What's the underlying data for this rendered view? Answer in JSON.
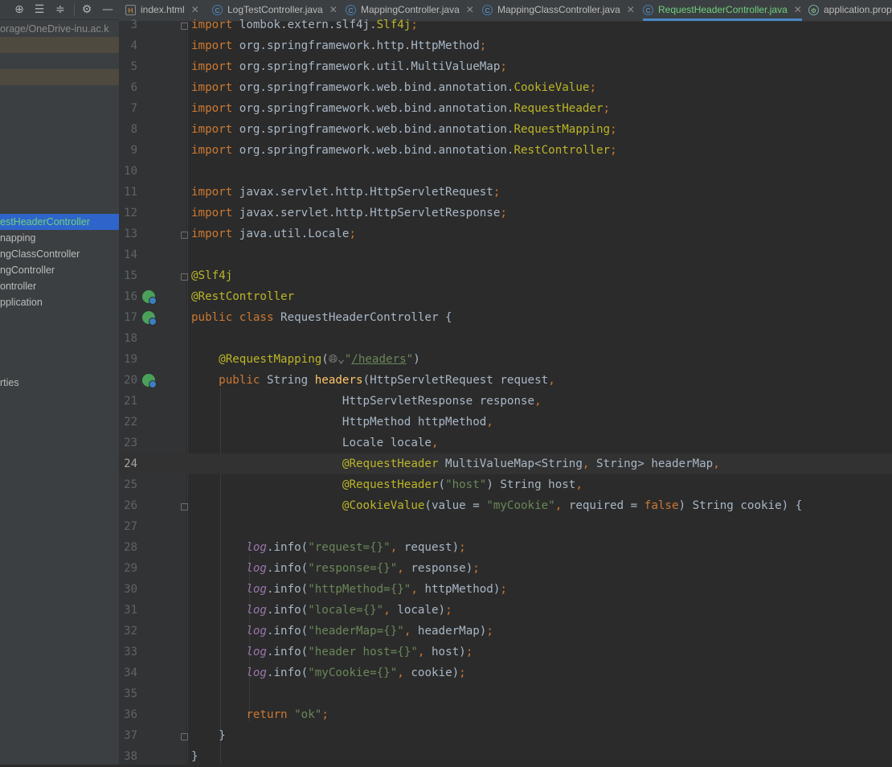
{
  "sidebar": {
    "toolbar_icons": [
      "target-icon",
      "expand-all-icon",
      "collapse-all-icon",
      "gear-icon",
      "minimize-icon"
    ],
    "project_path": "orage/OneDrive-inu.ac.k",
    "items": [
      {
        "label": "estHeaderController",
        "selected": true
      },
      {
        "label": "napping",
        "selected": false
      },
      {
        "label": "ngClassController",
        "selected": false
      },
      {
        "label": "ngController",
        "selected": false
      },
      {
        "label": "ontroller",
        "selected": false
      },
      {
        "label": "pplication",
        "selected": false
      },
      {
        "label": "rties",
        "selected": false
      }
    ]
  },
  "tabs": [
    {
      "label": "index.html",
      "icon": "html-file-icon"
    },
    {
      "label": "LogTestController.java",
      "icon": "java-class-icon"
    },
    {
      "label": "MappingController.java",
      "icon": "java-class-icon"
    },
    {
      "label": "MappingClassController.java",
      "icon": "java-class-icon"
    },
    {
      "label": "RequestHeaderController.java",
      "icon": "java-class-icon",
      "active": true
    },
    {
      "label": "application.prop",
      "icon": "properties-file-icon"
    }
  ],
  "editor": {
    "current_line": 24,
    "lines": [
      {
        "n": "3",
        "t": "import lombok.extern.slf4j.Slf4j;"
      },
      {
        "n": "4",
        "t": "import org.springframework.http.HttpMethod;"
      },
      {
        "n": "5",
        "t": "import org.springframework.util.MultiValueMap;"
      },
      {
        "n": "6",
        "t": "import org.springframework.web.bind.annotation.CookieValue;"
      },
      {
        "n": "7",
        "t": "import org.springframework.web.bind.annotation.RequestHeader;"
      },
      {
        "n": "8",
        "t": "import org.springframework.web.bind.annotation.RequestMapping;"
      },
      {
        "n": "9",
        "t": "import org.springframework.web.bind.annotation.RestController;"
      },
      {
        "n": "10",
        "t": ""
      },
      {
        "n": "11",
        "t": "import javax.servlet.http.HttpServletRequest;"
      },
      {
        "n": "12",
        "t": "import javax.servlet.http.HttpServletResponse;"
      },
      {
        "n": "13",
        "t": "import java.util.Locale;"
      },
      {
        "n": "14",
        "t": ""
      },
      {
        "n": "15",
        "t": "@Slf4j"
      },
      {
        "n": "16",
        "t": "@RestController"
      },
      {
        "n": "17",
        "t": "public class RequestHeaderController {"
      },
      {
        "n": "18",
        "t": ""
      },
      {
        "n": "19",
        "t": "    @RequestMapping(\"/headers\")"
      },
      {
        "n": "20",
        "t": "    public String headers(HttpServletRequest request,"
      },
      {
        "n": "21",
        "t": "                          HttpServletResponse response,"
      },
      {
        "n": "22",
        "t": "                          HttpMethod httpMethod,"
      },
      {
        "n": "23",
        "t": "                          Locale locale,"
      },
      {
        "n": "24",
        "t": "                          @RequestHeader MultiValueMap<String, String> headerMap,"
      },
      {
        "n": "25",
        "t": "                          @RequestHeader(\"host\") String host,"
      },
      {
        "n": "26",
        "t": "                          @CookieValue(value = \"myCookie\", required = false) String cookie) {"
      },
      {
        "n": "27",
        "t": ""
      },
      {
        "n": "28",
        "t": "        log.info(\"request={}\", request);"
      },
      {
        "n": "29",
        "t": "        log.info(\"response={}\", response);"
      },
      {
        "n": "30",
        "t": "        log.info(\"httpMethod={}\", httpMethod);"
      },
      {
        "n": "31",
        "t": "        log.info(\"locale={}\", locale);"
      },
      {
        "n": "32",
        "t": "        log.info(\"headerMap={}\", headerMap);"
      },
      {
        "n": "33",
        "t": "        log.info(\"header host={}\", host);"
      },
      {
        "n": "34",
        "t": "        log.info(\"myCookie={}\", cookie);"
      },
      {
        "n": "35",
        "t": ""
      },
      {
        "n": "36",
        "t": "        return \"ok\";"
      },
      {
        "n": "37",
        "t": "    }"
      },
      {
        "n": "38",
        "t": "}"
      }
    ]
  }
}
